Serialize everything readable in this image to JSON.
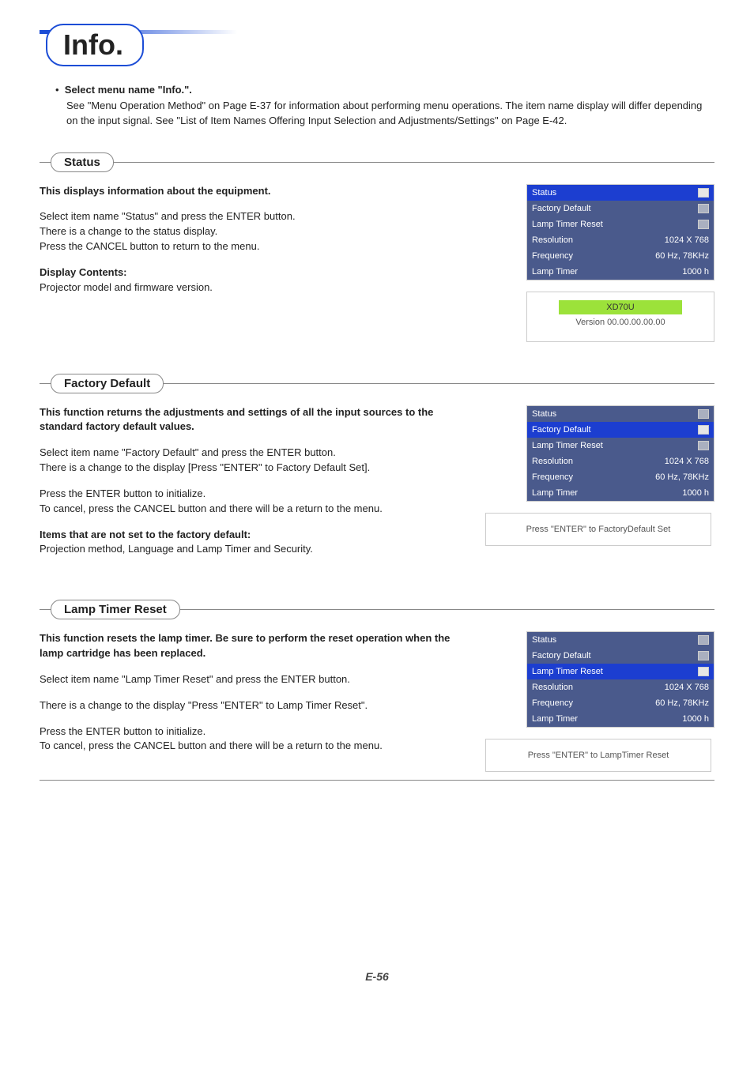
{
  "page": {
    "title": "Info.",
    "number": "E-56"
  },
  "intro": {
    "bullet_bold": "Select menu name \"Info.\".",
    "body": "See \"Menu Operation Method\" on Page E-37 for information about performing menu operations. The item name display will differ depending on the input signal. See \"List of Item Names Offering Input Selection and Adjustments/Settings\" on Page E-42."
  },
  "sections": {
    "status": {
      "title": "Status",
      "lead": "This displays information about the equipment.",
      "p1": "Select item name \"Status\" and press the ENTER button.\nThere is a change to the status display.\nPress the CANCEL button to return to the menu.",
      "p2_bold": "Display Contents:",
      "p2_body": "Projector model and firmware version."
    },
    "factory": {
      "title": "Factory Default",
      "lead": "This function returns the adjustments and settings of all the input sources to the standard factory default values.",
      "p1": "Select item name \"Factory Default\" and press the ENTER button.\nThere is a change to the display [Press \"ENTER\" to Factory Default Set].",
      "p2": "Press the ENTER button to initialize.\nTo cancel, press the CANCEL button and there will be a return to the menu.",
      "p3_bold": "Items that are not set to the factory default:",
      "p3_body": "Projection method, Language and Lamp Timer and Security."
    },
    "lamp": {
      "title": "Lamp Timer Reset",
      "lead": "This function resets the lamp timer. Be sure to perform the reset operation when the lamp cartridge has been replaced.",
      "p1": "Select item name \"Lamp Timer Reset\" and press the ENTER button.",
      "p2": "There is a change to the display \"Press \"ENTER\" to Lamp Timer Reset\".",
      "p3": "Press the ENTER button to initialize.\nTo cancel, press the CANCEL button and there will be a return to the menu."
    }
  },
  "menu_labels": {
    "status": "Status",
    "factory_default": "Factory Default",
    "lamp_timer_reset": "Lamp Timer Reset",
    "resolution": "Resolution",
    "frequency": "Frequency",
    "lamp_timer": "Lamp Timer"
  },
  "menu_values": {
    "resolution": "1024 X 768",
    "frequency": "60 Hz, 78KHz",
    "lamp_timer": "1000 h"
  },
  "status_dialog": {
    "model": "XD70U",
    "version": "Version 00.00.00.00.00"
  },
  "factory_dialog": {
    "text": "Press \"ENTER\" to FactoryDefault Set"
  },
  "lamp_dialog": {
    "text": "Press \"ENTER\" to LampTimer Reset"
  }
}
